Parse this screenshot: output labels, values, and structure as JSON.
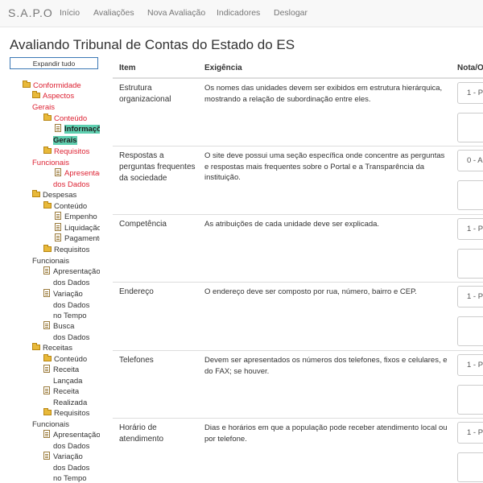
{
  "navbar": {
    "brand": "S.A.P.O",
    "items": [
      "Início",
      "Avaliações",
      "Nova Avaliação",
      "Indicadores",
      "Deslogar"
    ]
  },
  "page": {
    "title": "Avaliando Tribunal de Contas do Estado do ES",
    "expand_label": "Expandir tudo"
  },
  "tree": {
    "nodes": [
      {
        "icon": "folder-open",
        "lines": [
          "Conformidade"
        ]
      },
      {
        "icon": "folder-open",
        "lines": [
          "Aspectos",
          "Gerais"
        ]
      },
      {
        "icon": "folder-open",
        "lines": [
          "Conteúdo"
        ]
      },
      {
        "icon": "document",
        "lines": [
          "Informações",
          "Gerais"
        ],
        "selected": true
      },
      {
        "icon": "folder-open",
        "lines": [
          "Requisitos",
          "Funcionais"
        ]
      },
      {
        "icon": "document",
        "lines": [
          "Apresentação",
          "dos Dados"
        ]
      },
      {
        "icon": "folder-open",
        "lines": [
          "Despesas"
        ],
        "dark": true
      },
      {
        "icon": "folder-open",
        "lines": [
          "Conteúdo"
        ],
        "dark": true
      },
      {
        "icon": "document",
        "lines": [
          "Empenho"
        ],
        "dark": true
      },
      {
        "icon": "document",
        "lines": [
          "Liquidação"
        ],
        "dark": true
      },
      {
        "icon": "document",
        "lines": [
          "Pagamento"
        ],
        "dark": true
      },
      {
        "icon": "folder-open",
        "lines": [
          "Requisitos",
          "Funcionais"
        ],
        "dark": true
      },
      {
        "icon": "document",
        "lines": [
          "Apresentação",
          "dos Dados"
        ],
        "dark": true
      },
      {
        "icon": "document",
        "lines": [
          "Variação",
          "dos Dados",
          "no Tempo"
        ],
        "dark": true
      },
      {
        "icon": "document",
        "lines": [
          "Busca",
          "dos Dados"
        ],
        "dark": true
      },
      {
        "icon": "folder-open",
        "lines": [
          "Receitas"
        ],
        "dark": true
      },
      {
        "icon": "folder-open",
        "lines": [
          "Conteúdo"
        ],
        "dark": true
      },
      {
        "icon": "document",
        "lines": [
          "Receita",
          "Lançada"
        ],
        "dark": true
      },
      {
        "icon": "document",
        "lines": [
          "Receita",
          "Realizada"
        ],
        "dark": true
      },
      {
        "icon": "folder-open",
        "lines": [
          "Requisitos",
          "Funcionais"
        ],
        "dark": true
      },
      {
        "icon": "document",
        "lines": [
          "Apresentação",
          "dos Dados"
        ],
        "dark": true
      },
      {
        "icon": "document",
        "lines": [
          "Variação",
          "dos Dados",
          "no Tempo"
        ],
        "dark": true
      }
    ]
  },
  "table": {
    "headers": {
      "item": "Item",
      "requirement": "Exigência",
      "score": "Nota/O"
    },
    "rows": [
      {
        "item": "Estrutura organizacional",
        "requirement": "Os nomes das unidades devem ser exibidos em estrutura hierárquica, mostrando a relação de subordinação entre eles.",
        "score": "1 - P"
      },
      {
        "item": "Respostas a perguntas frequentes da sociedade",
        "requirement": "O site deve possui uma seção específica onde concentre as perguntas e respostas mais frequentes sobre o Portal e a Transparência da instituição.",
        "score": "0 - A"
      },
      {
        "item": "Competência",
        "requirement": "As atribuições de cada unidade deve ser explicada.",
        "score": "1 - P"
      },
      {
        "item": "Endereço",
        "requirement": "O endereço deve ser composto por rua, número, bairro e CEP.",
        "score": "1 - P"
      },
      {
        "item": "Telefones",
        "requirement": "Devem ser apresentados os números dos telefones, fixos e celulares, e do FAX; se houver.",
        "score": "1 - P"
      },
      {
        "item": "Horário de atendimento",
        "requirement": "Dias e horários em que a população pode receber atendimento local ou por telefone.",
        "score": "1 - P"
      }
    ]
  }
}
